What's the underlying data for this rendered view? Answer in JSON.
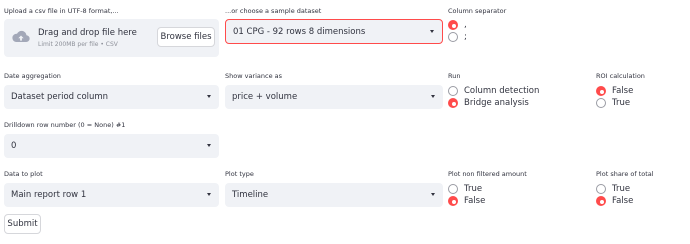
{
  "upload": {
    "label": "Upload a csv file in UTF-8 format,...",
    "drop_title": "Drag and drop file here",
    "drop_sub": "Limit 200MB per file • CSV",
    "browse_label": "Browse files",
    "icon": "cloud-upload-icon"
  },
  "sample": {
    "label": "...or choose a sample dataset",
    "value": "01 CPG - 92 rows 8 dimensions"
  },
  "separator": {
    "label": "Column separator",
    "options": [
      ",",
      ";"
    ],
    "selected": ","
  },
  "date_aggregation": {
    "label": "Date aggregation",
    "value": "Dataset period column"
  },
  "variance": {
    "label": "Show variance as",
    "value": "price + volume"
  },
  "run": {
    "label": "Run",
    "options": [
      "Column detection",
      "Bridge analysis"
    ],
    "selected": "Bridge analysis"
  },
  "roi": {
    "label": "ROI calculation",
    "options": [
      "False",
      "True"
    ],
    "selected": "False"
  },
  "drilldown": {
    "label": "Drilldown row number (0 = None) #1",
    "value": "0"
  },
  "data_to_plot": {
    "label": "Data to plot",
    "value": "Main report row 1"
  },
  "plot_type": {
    "label": "Plot type",
    "value": "Timeline"
  },
  "plot_non_filtered": {
    "label": "Plot non filtered amount",
    "options": [
      "True",
      "False"
    ],
    "selected": "False"
  },
  "plot_share": {
    "label": "Plot share of total",
    "options": [
      "True",
      "False"
    ],
    "selected": "False"
  },
  "submit": {
    "label": "Submit"
  },
  "colors": {
    "accent": "#ff4b4b",
    "field_bg": "#f0f2f6",
    "text": "#31333f"
  }
}
